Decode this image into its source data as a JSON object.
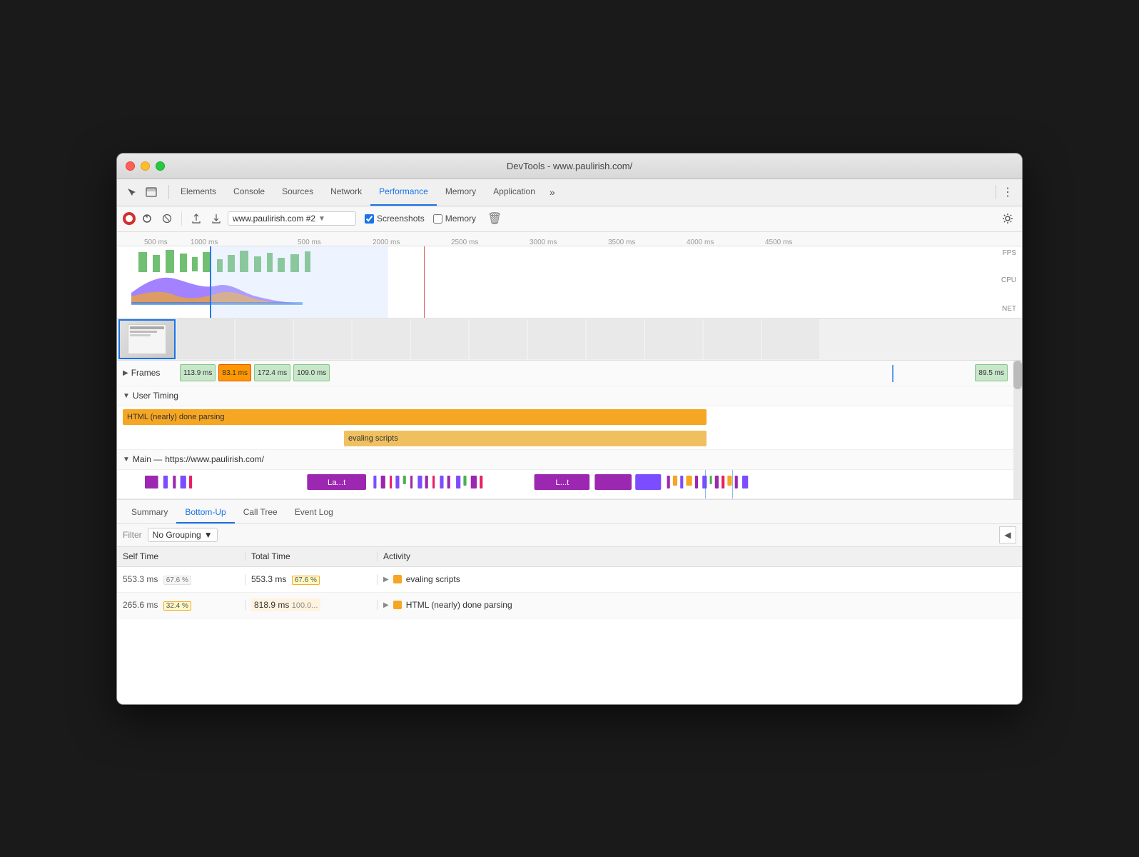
{
  "window": {
    "title": "DevTools - www.paulirish.com/"
  },
  "tabs": {
    "items": [
      {
        "label": "Elements",
        "active": false
      },
      {
        "label": "Console",
        "active": false
      },
      {
        "label": "Sources",
        "active": false
      },
      {
        "label": "Network",
        "active": false
      },
      {
        "label": "Performance",
        "active": true
      },
      {
        "label": "Memory",
        "active": false
      },
      {
        "label": "Application",
        "active": false
      }
    ],
    "overflow_label": "»",
    "more_label": "⋮"
  },
  "toolbar": {
    "record_title": "Record",
    "reload_title": "Reload and start recording",
    "clear_title": "Clear",
    "upload_title": "Load profile",
    "download_title": "Save profile",
    "url_value": "www.paulirish.com #2",
    "screenshots_label": "Screenshots",
    "memory_label": "Memory",
    "screenshots_checked": true,
    "memory_checked": false,
    "settings_title": "Settings"
  },
  "timeline": {
    "ruler_marks": [
      "500 ms",
      "1000 ms",
      "500 ms",
      "2000 ms",
      "2500 ms",
      "3000 ms",
      "3500 ms",
      "4000 ms",
      "4500 ms"
    ],
    "bottom_marks": [
      "500 ms",
      "1000 ms"
    ],
    "three_dots": "...",
    "fps_label": "FPS",
    "cpu_label": "CPU",
    "net_label": "NET"
  },
  "frames": {
    "label": "Frames",
    "items": [
      {
        "value": "113.9 ms",
        "type": "normal"
      },
      {
        "value": "83.1 ms",
        "type": "highlighted"
      },
      {
        "value": "172.4 ms",
        "type": "normal"
      },
      {
        "value": "109.0 ms",
        "type": "normal"
      },
      {
        "value": "89.5 ms",
        "type": "normal"
      }
    ]
  },
  "user_timing": {
    "label": "User Timing",
    "bars": [
      {
        "label": "",
        "text": "HTML (nearly) done parsing",
        "type": "orange",
        "left": "0%",
        "width": "65%"
      },
      {
        "label": "",
        "text": "evaling scripts",
        "type": "orange",
        "left": "25%",
        "width": "45%"
      }
    ]
  },
  "main_thread": {
    "label": "Main",
    "url": "https://www.paulirish.com/",
    "blocks": [
      {
        "text": "La...t",
        "type": "purple",
        "left": "23%",
        "width": "8%"
      },
      {
        "text": "L...t",
        "type": "purple",
        "left": "53%",
        "width": "8%"
      }
    ]
  },
  "bottom_tabs": [
    {
      "label": "Summary",
      "active": false
    },
    {
      "label": "Bottom-Up",
      "active": true
    },
    {
      "label": "Call Tree",
      "active": false
    },
    {
      "label": "Event Log",
      "active": false
    }
  ],
  "filter": {
    "placeholder": "Filter",
    "grouping": "No Grouping",
    "grouping_arrow": "▼"
  },
  "table": {
    "headers": {
      "self_time": "Self Time",
      "total_time": "Total Time",
      "activity": "Activity"
    },
    "rows": [
      {
        "self_time": "553.3 ms",
        "self_pct": "67.6 %",
        "total_time": "553.3 ms",
        "total_pct": "67.6 %",
        "color": "#f5a623",
        "activity": "evaling scripts"
      },
      {
        "self_time": "265.6 ms",
        "self_pct": "32.4 %",
        "total_time": "818.9 ms100.0...",
        "total_pct": "",
        "color": "#f5a623",
        "activity": "HTML (nearly) done parsing"
      }
    ]
  }
}
